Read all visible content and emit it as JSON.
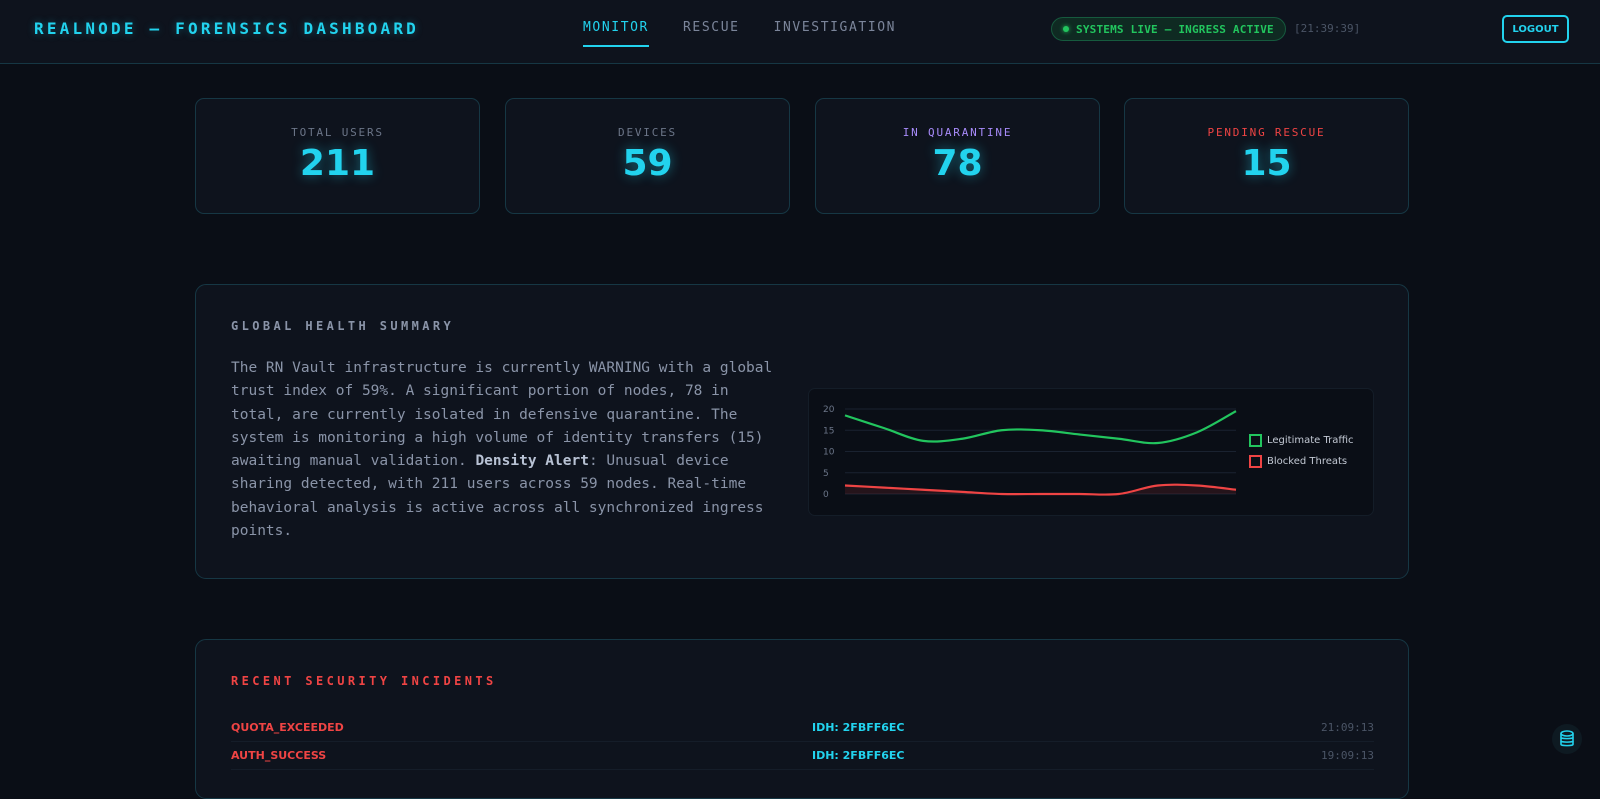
{
  "header": {
    "brand": "REALNODE — FORENSICS DASHBOARD",
    "nav": [
      "MONITOR",
      "RESCUE",
      "INVESTIGATION"
    ],
    "status": "SYSTEMS LIVE — INGRESS ACTIVE",
    "clock": "[21:39:39]",
    "logout_label": "LOGOUT"
  },
  "stats": [
    {
      "label": "TOTAL USERS",
      "value": "211"
    },
    {
      "label": "DEVICES",
      "value": "59"
    },
    {
      "label": "IN QUARANTINE",
      "value": "78"
    },
    {
      "label": "PENDING RESCUE",
      "value": "15"
    }
  ],
  "health": {
    "title": "GLOBAL HEALTH SUMMARY",
    "text_before": "The RN Vault infrastructure is currently WARNING with a global trust index of 59%. A significant portion of nodes, 78 in total, are currently isolated in defensive quarantine. The system is monitoring a high volume of identity transfers (15) awaiting manual validation. ",
    "alert_label": "Density Alert",
    "text_after": ": Unusual device sharing detected, with 211 users across 59 nodes. Real-time behavioral analysis is active across all synchronized ingress points."
  },
  "chart_data": {
    "type": "line",
    "ylim": [
      0,
      20
    ],
    "yticks": [
      "20",
      "15",
      "10",
      "5",
      "0"
    ],
    "x": [
      0,
      1,
      2,
      3,
      4,
      5,
      6,
      7,
      8,
      9,
      10
    ],
    "series": [
      {
        "name": "Legitimate Traffic",
        "color": "#22c55e",
        "values": [
          18.5,
          15.5,
          12.5,
          13,
          15,
          15,
          14,
          13,
          12,
          14.5,
          19.5
        ]
      },
      {
        "name": "Blocked Threats",
        "color": "#ef4444",
        "values": [
          2,
          1.5,
          1,
          0.5,
          0,
          0,
          0,
          0,
          2,
          2,
          1
        ]
      }
    ],
    "legend": "right",
    "grid": true
  },
  "incidents": {
    "title": "RECENT SECURITY INCIDENTS",
    "rows": [
      {
        "type": "QUOTA_EXCEEDED",
        "id": "IDH: 2FBFF6EC",
        "time": "21:09:13"
      },
      {
        "type": "AUTH_SUCCESS",
        "id": "IDH: 2FBFF6EC",
        "time": "19:09:13"
      }
    ]
  },
  "icons": {
    "fab": "database-icon"
  }
}
